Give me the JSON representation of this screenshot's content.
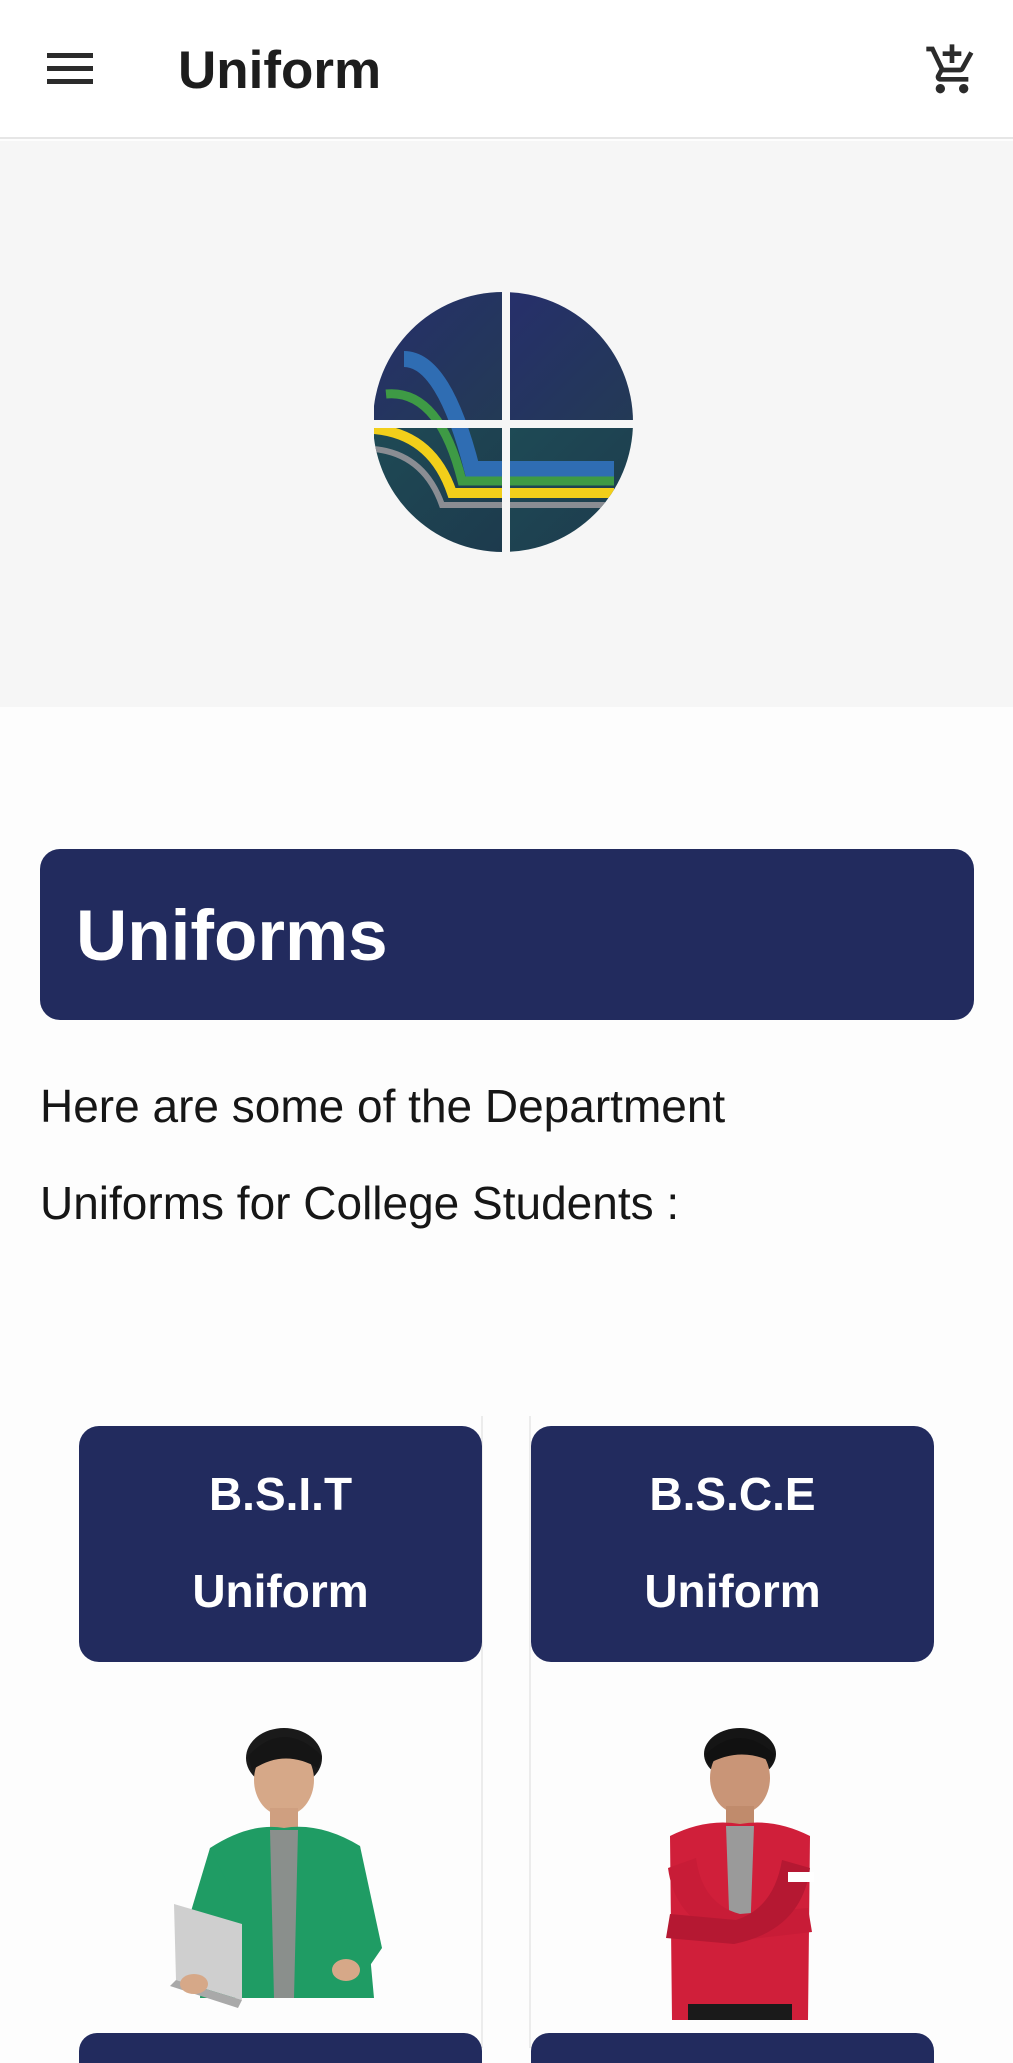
{
  "appbar": {
    "title": "Uniform",
    "menu_icon": "hamburger-menu-icon",
    "cart_icon": "add-shopping-cart-icon"
  },
  "hero": {
    "logo": "school-logo"
  },
  "section": {
    "title": "Uniforms",
    "intro_line1": "Here are some of the Department",
    "intro_line2": "Uniforms for College Students :"
  },
  "cards": [
    {
      "line1": "B.S.I.T",
      "line2": "Uniform",
      "photo": "student-in-green-uniform",
      "color": "#1e9b62"
    },
    {
      "line1": "B.S.C.E",
      "line2": "Uniform",
      "photo": "student-in-red-uniform",
      "color": "#d4213d"
    }
  ],
  "colors": {
    "primary": "#222b5e",
    "hero_bg": "#f6f6f6",
    "page_bg": "#fdfdfd"
  }
}
